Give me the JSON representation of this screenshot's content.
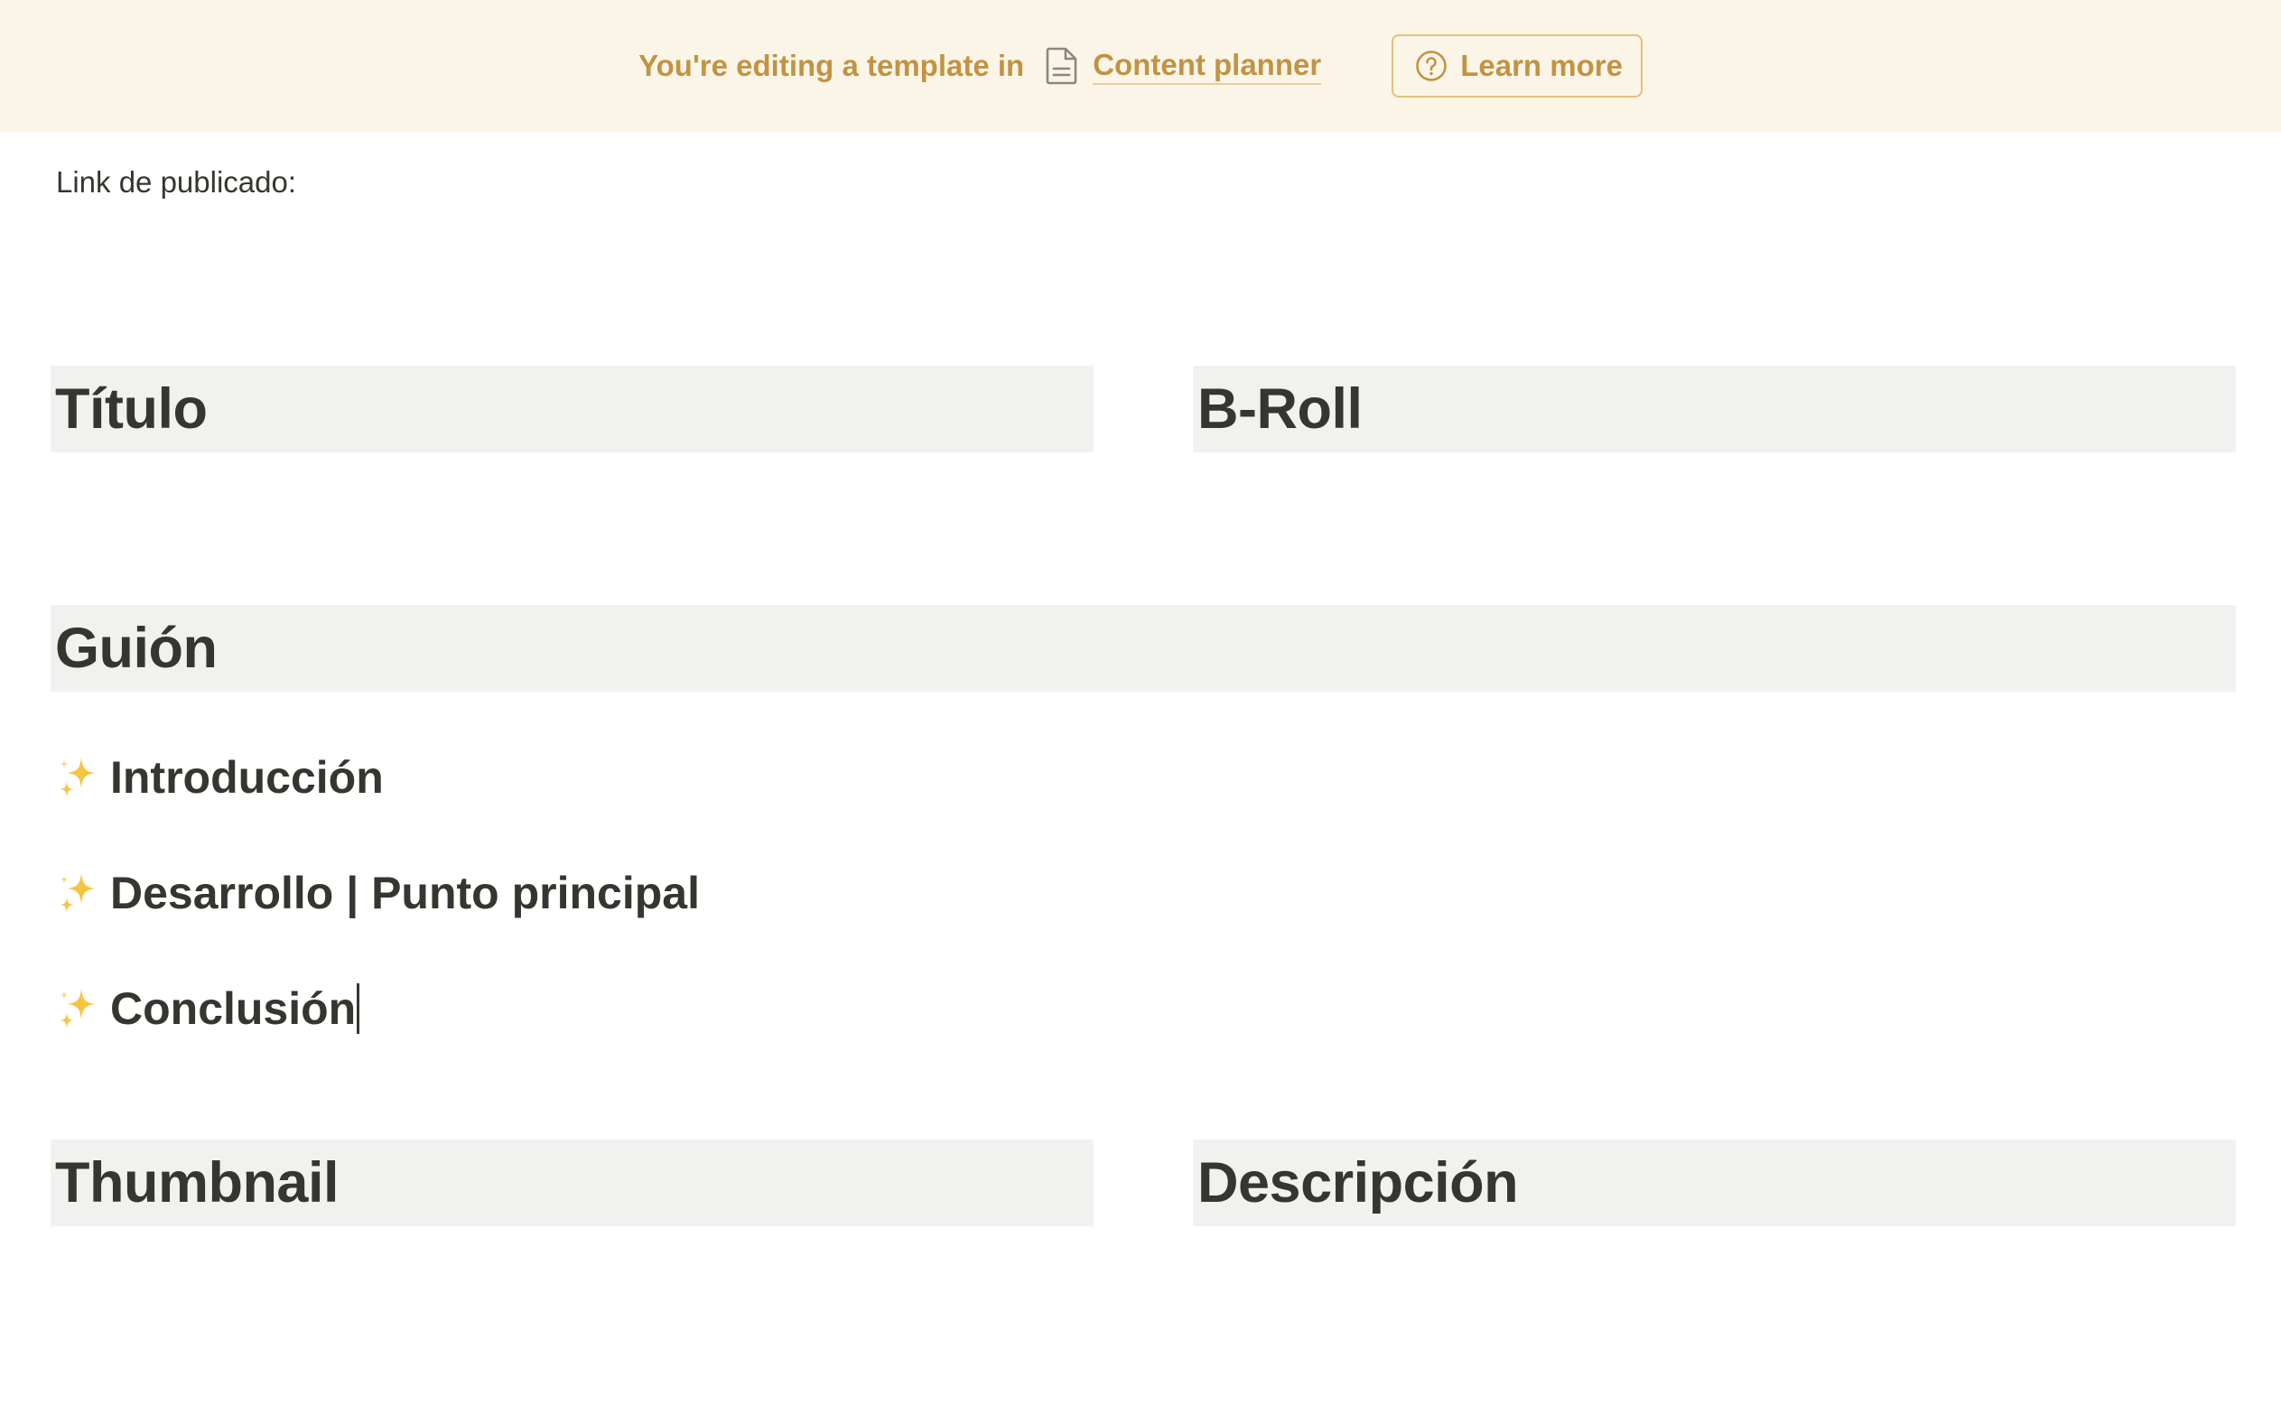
{
  "banner": {
    "prefix_text": "You're editing a template in",
    "doc_link_text": "Content planner",
    "learn_more_label": "Learn more",
    "accent_color": "#c29343",
    "background_color": "#fbf5e8"
  },
  "page": {
    "link_label": "Link de publicado:",
    "headings": {
      "titulo": "Título",
      "broll": "B-Roll",
      "guion": "Guión",
      "thumbnail": "Thumbnail",
      "descripcion": "Descripción"
    },
    "script_sections": [
      {
        "icon": "sparkles-icon",
        "label": "Introducción"
      },
      {
        "icon": "sparkles-icon",
        "label": "Desarrollo | Punto principal"
      },
      {
        "icon": "sparkles-icon",
        "label": "Conclusión"
      }
    ],
    "heading_background": "#f1f1ef",
    "text_color": "#37352f"
  }
}
